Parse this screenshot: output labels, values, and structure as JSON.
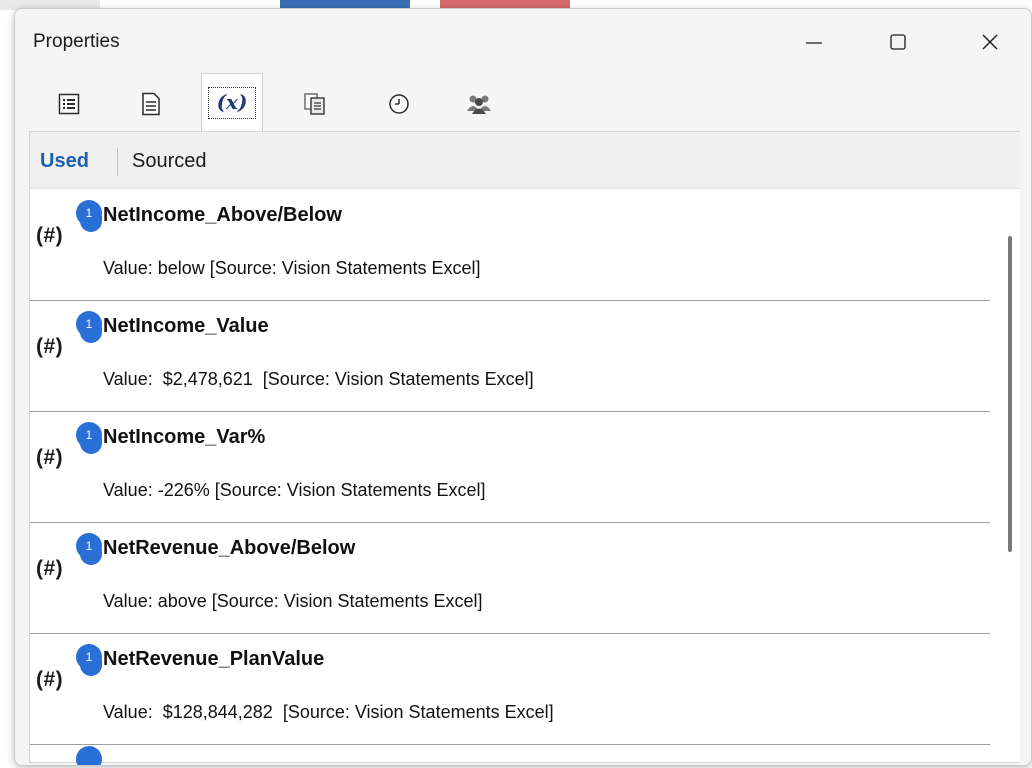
{
  "window": {
    "title": "Properties",
    "controls": {
      "minimize": "minimize-icon",
      "maximize": "maximize-icon",
      "close": "close-icon"
    }
  },
  "toolbar": {
    "tools": [
      {
        "icon": "list-view-icon"
      },
      {
        "icon": "document-icon"
      },
      {
        "icon": "variables-icon",
        "label": "(x)",
        "active": true
      },
      {
        "icon": "copy-document-icon"
      },
      {
        "icon": "clock-icon"
      },
      {
        "icon": "users-icon"
      }
    ]
  },
  "subtabs": {
    "used": "Used",
    "sourced": "Sourced",
    "active": "Used"
  },
  "variables": [
    {
      "name": "NetIncome_Above/Below",
      "value": "Value: below [Source: Vision Statements Excel]",
      "badge": "1",
      "type_label": "(#)"
    },
    {
      "name": "NetIncome_Value",
      "value": "Value:  $2,478,621  [Source: Vision Statements Excel]",
      "badge": "1",
      "type_label": "(#)"
    },
    {
      "name": "NetIncome_Var%",
      "value": "Value: -226% [Source: Vision Statements Excel]",
      "badge": "1",
      "type_label": "(#)"
    },
    {
      "name": "NetRevenue_Above/Below",
      "value": "Value: above [Source: Vision Statements Excel]",
      "badge": "1",
      "type_label": "(#)"
    },
    {
      "name": "NetRevenue_PlanValue",
      "value": "Value:  $128,844,282  [Source: Vision Statements Excel]",
      "badge": "1",
      "type_label": "(#)"
    }
  ],
  "colors": {
    "accent": "#1a5fb4",
    "badge": "#2a6fd6",
    "separator": "#9e9e9e",
    "window_bg": "#f5f5f5"
  }
}
